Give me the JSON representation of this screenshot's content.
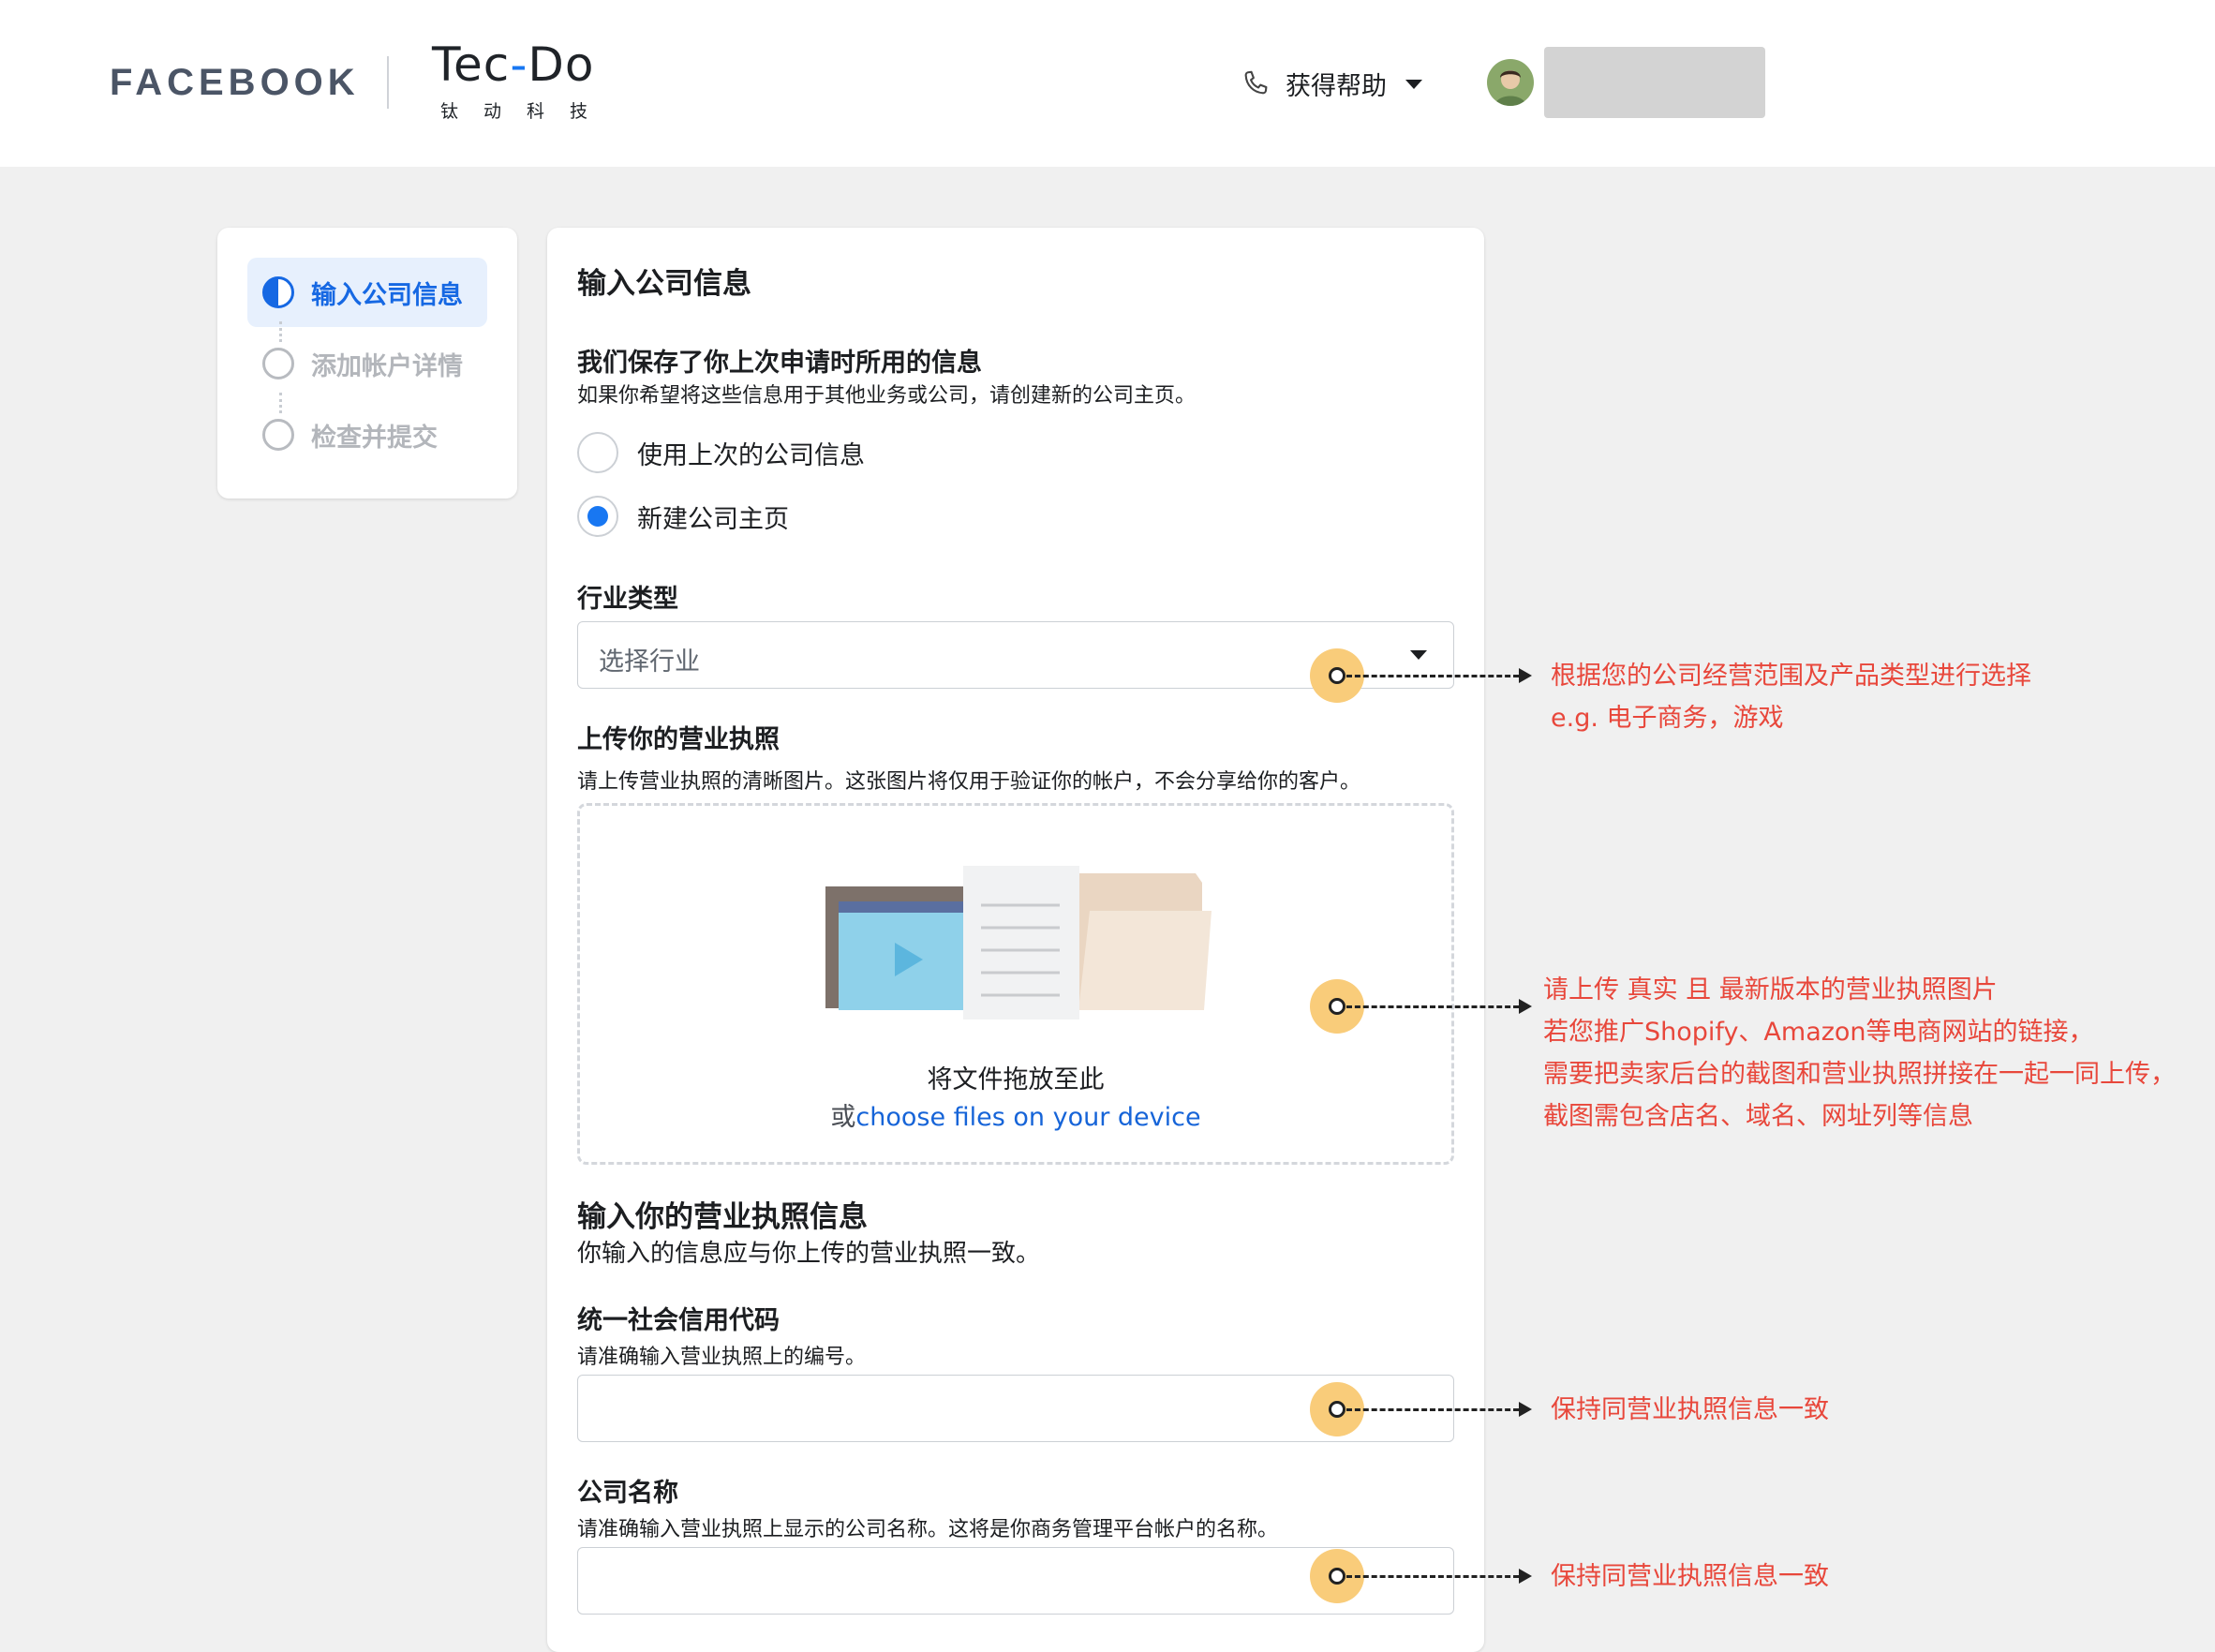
{
  "header": {
    "facebook_logo": "FACEBOOK",
    "partner_logo_main": "Tec",
    "partner_logo_dash": "-",
    "partner_logo_end": "Do",
    "partner_logo_sub": "钛动科技",
    "help_label": "获得帮助"
  },
  "stepper": {
    "steps": [
      {
        "label": "输入公司信息",
        "state": "active"
      },
      {
        "label": "添加帐户详情",
        "state": "inactive"
      },
      {
        "label": "检查并提交",
        "state": "inactive"
      }
    ]
  },
  "form": {
    "title": "输入公司信息",
    "saved_info": {
      "heading": "我们保存了你上次申请时所用的信息",
      "description": "如果你希望将这些信息用于其他业务或公司，请创建新的公司主页。",
      "options": [
        {
          "label": "使用上次的公司信息",
          "selected": false
        },
        {
          "label": "新建公司主页",
          "selected": true
        }
      ]
    },
    "industry": {
      "label": "行业类型",
      "placeholder": "选择行业"
    },
    "upload": {
      "heading": "上传你的营业执照",
      "description": "请上传营业执照的清晰图片。这张图片将仅用于验证你的帐户，不会分享给你的客户。",
      "drop_text": "将文件拖放至此",
      "or_text": "或",
      "choose_link": "choose files on your device"
    },
    "license_info": {
      "heading": "输入你的营业执照信息",
      "description": "你输入的信息应与你上传的营业执照一致。"
    },
    "credit_code": {
      "label": "统一社会信用代码",
      "description": "请准确输入营业执照上的编号。",
      "value": ""
    },
    "company_name": {
      "label": "公司名称",
      "description": "请准确输入营业执照上显示的公司名称。这将是你商务管理平台帐户的名称。",
      "value": ""
    }
  },
  "annotations": {
    "industry": [
      "根据您的公司经营范围及产品类型进行选择",
      "e.g. 电子商务，游戏"
    ],
    "upload": [
      "请上传 真实 且 最新版本的营业执照图片",
      "若您推广Shopify、Amazon等电商网站的链接，",
      "需要把卖家后台的截图和营业执照拼接在一起一同上传，",
      "截图需包含店名、域名、网址列等信息"
    ],
    "credit_code": "保持同营业执照信息一致",
    "company_name": "保持同营业执照信息一致"
  },
  "colors": {
    "accent": "#1877f2",
    "annotation": "#e8473b",
    "marker": "#f9cc7a"
  }
}
